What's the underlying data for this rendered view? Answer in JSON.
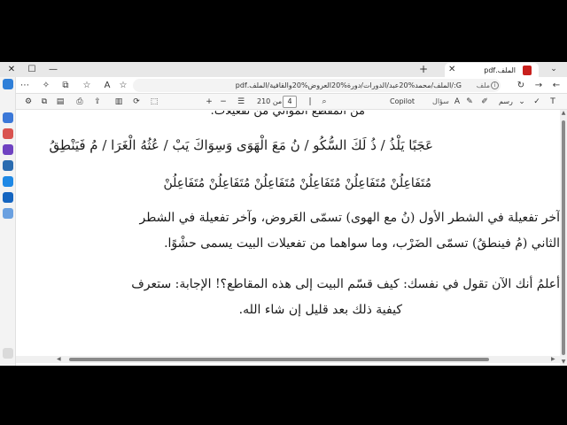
{
  "titlebar": {
    "tab_title": "الملف.pdf",
    "new_tab": "+",
    "tab_close": "✕",
    "minimize": "—",
    "maximize": "☐",
    "close": "✕",
    "overflow": "⌄"
  },
  "addressbar": {
    "url": "G:/الملف/محمد%20عبد/الدورات/دورة%20العروض%20والقافية/الملف.pdf",
    "file_label": "ملف",
    "info": "i"
  },
  "pdf_toolbar": {
    "page_current": "4",
    "page_of": "من 210",
    "copilot_label": "Copilot",
    "ask_label": "سؤال",
    "draw_label": "رسم",
    "zoom_out": "−",
    "zoom_in": "+"
  },
  "document": {
    "lines": [
      "من المقطع الموالي من تفعيلات:",
      "عَجَبًا يَلْذُ / ذُ لَكَ السُّكُو / نُ مَعَ الْهَوَى   وَسِوَاكَ يَبْ / عُثُهُ الْغَرَا / مُ فَيَنْطِقُ",
      "مُتَفَاعِلُنْ مُتَفَاعِلُنْ مُتَفَاعِلُنْ    مُتَفَاعِلُنْ مُتَفَاعِلُنْ مُتَفَاعِلُنْ",
      "آخر تفعيلة في الشطر الأول (نُ مع الهوى) تسمّى العَروض، وآخر تفعيلة في الشطر",
      "الثاني (مُ فينطقُ) تسمّى الضَرْب، وما سواهما من تفعيلات البيت يسمى حشْوًا.",
      "أعلمُ أنك الآن تقول في نفسك: كيف قسّم البيت إلى هذه المقاطع؟! الإجابة: ستعرف",
      "كيفية ذلك بعد قليل إن شاء الله."
    ]
  },
  "colors": {
    "pdf_icon": "#c8201d",
    "scroll_thumb": "#8a8a8a"
  }
}
